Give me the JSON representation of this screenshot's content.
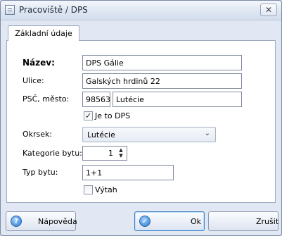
{
  "window": {
    "title": "Pracoviště / DPS",
    "close_glyph": "✕"
  },
  "tabs": [
    {
      "label": "Základní údaje"
    }
  ],
  "form": {
    "nazev": {
      "label": "Název:",
      "value": "DPS Gálie"
    },
    "ulice": {
      "label": "Ulice:",
      "value": "Galských hrdinů 22"
    },
    "psc_mesto": {
      "label": "PSČ, město:",
      "psc": "98563",
      "mesto": "Lutécie"
    },
    "je_to_dps": {
      "label": "Je to DPS",
      "checked": true
    },
    "okrsek": {
      "label": "Okrsek:",
      "value": "Lutécie"
    },
    "kategorie_bytu": {
      "label": "Kategorie bytu:",
      "value": "1"
    },
    "typ_bytu": {
      "label": "Typ bytu:",
      "value": "1+1"
    },
    "vytah": {
      "label": "Výtah",
      "checked": false
    }
  },
  "buttons": {
    "help": {
      "label": "Nápověda",
      "icon": "help-icon"
    },
    "ok": {
      "label": "Ok",
      "icon": "ok-icon"
    },
    "cancel": {
      "label": "Zrušit"
    }
  },
  "glyphs": {
    "check": "✓",
    "chevron": "⌄",
    "up": "▲",
    "down": "▼"
  }
}
